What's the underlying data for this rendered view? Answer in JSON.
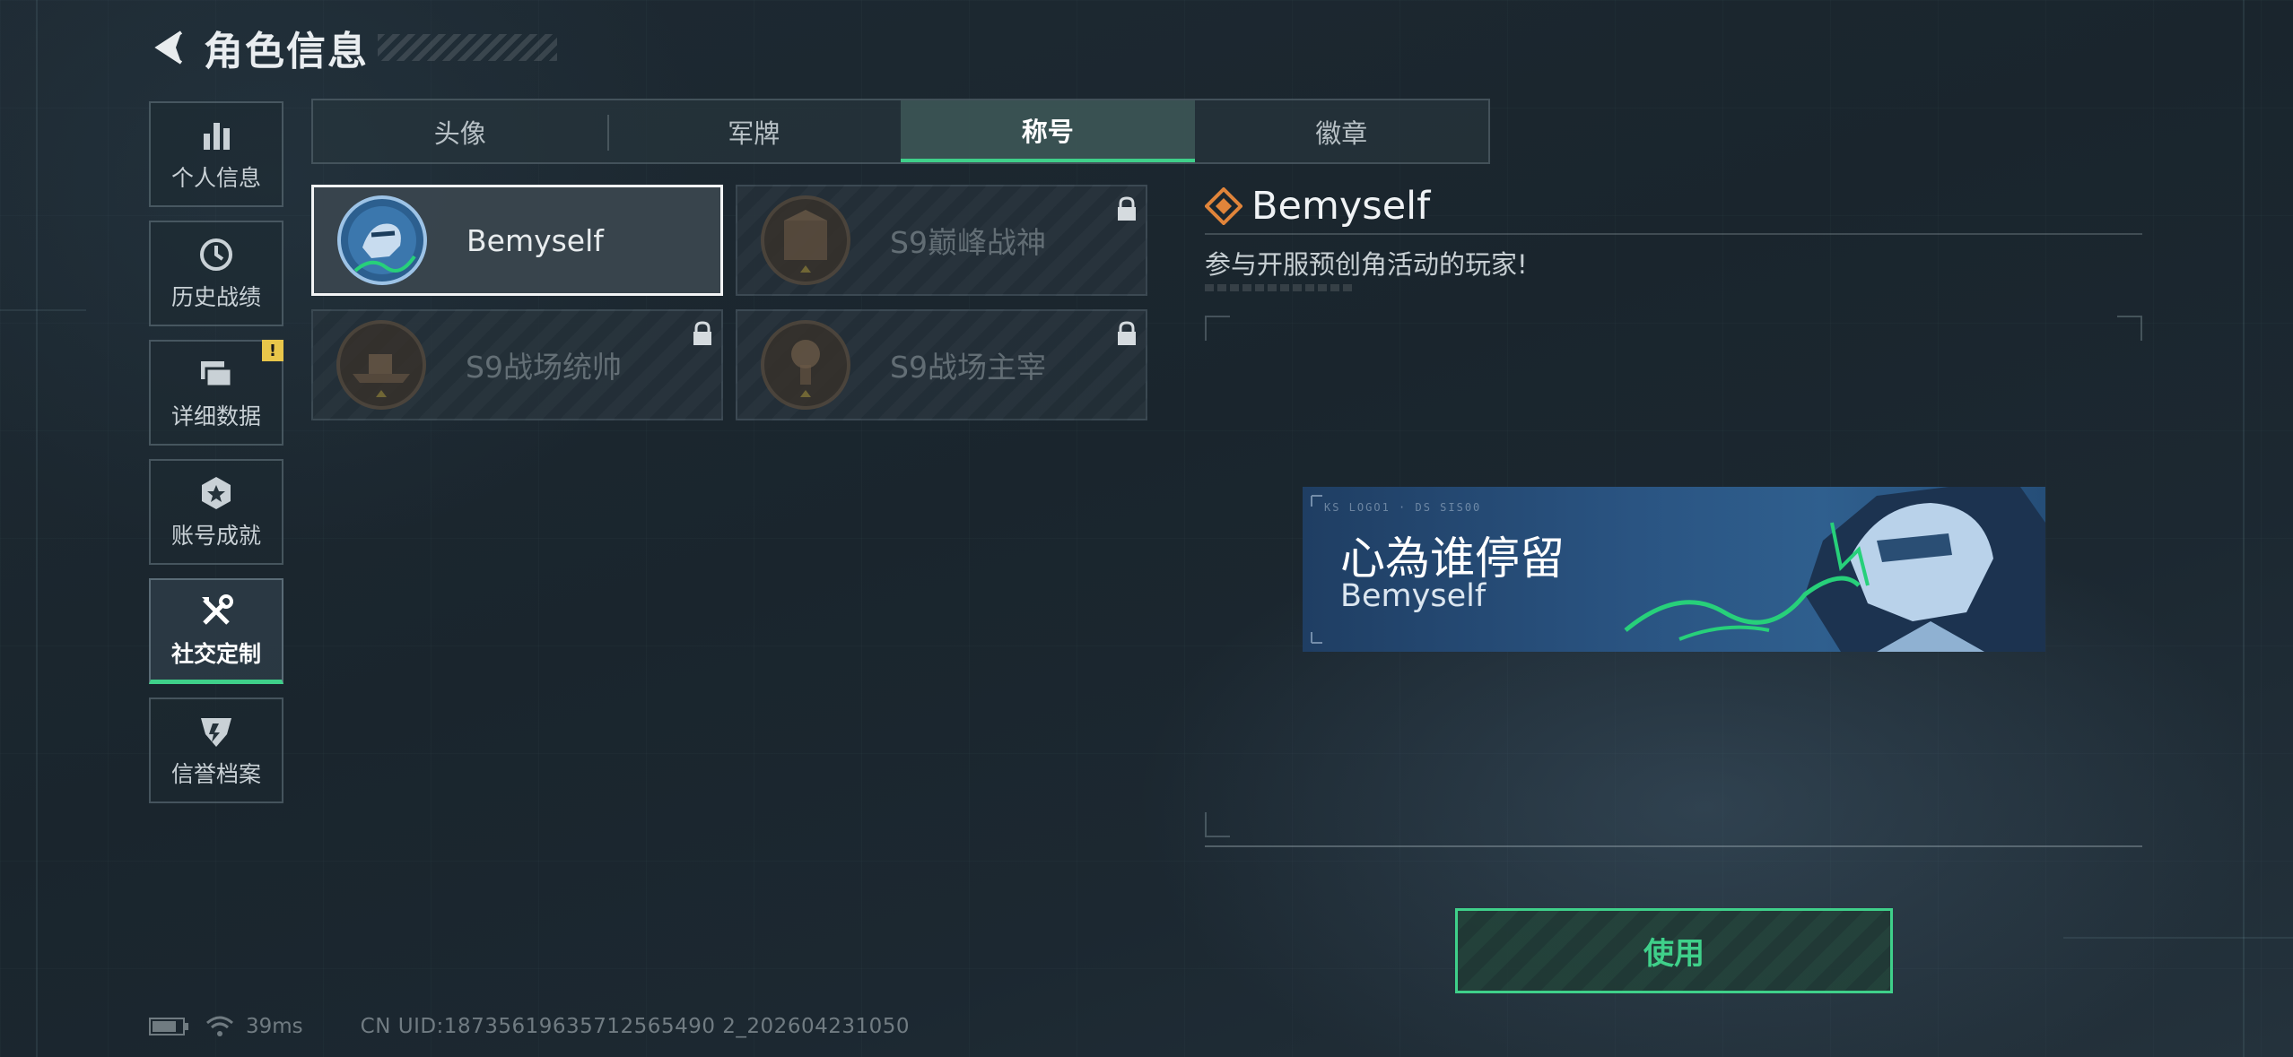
{
  "header": {
    "title": "角色信息"
  },
  "sidebar": {
    "items": [
      {
        "label": "个人信息",
        "icon": "bar-chart-icon"
      },
      {
        "label": "历史战绩",
        "icon": "history-clock-icon"
      },
      {
        "label": "详细数据",
        "icon": "folder-icon",
        "badge": "!"
      },
      {
        "label": "账号成就",
        "icon": "medal-icon"
      },
      {
        "label": "社交定制",
        "icon": "tools-icon",
        "active": true
      },
      {
        "label": "信誉档案",
        "icon": "shield-emblem-icon"
      }
    ]
  },
  "tabs": [
    {
      "label": "头像"
    },
    {
      "label": "军牌"
    },
    {
      "label": "称号",
      "active": true
    },
    {
      "label": "徽章"
    }
  ],
  "titles": [
    {
      "name": "Bemyself",
      "locked": false,
      "selected": true
    },
    {
      "name": "S9巅峰战神",
      "locked": true
    },
    {
      "name": "S9战场统帅",
      "locked": true
    },
    {
      "name": "S9战场主宰",
      "locked": true
    }
  ],
  "detail": {
    "name": "Bemyself",
    "description": "参与开服预创角活动的玩家!",
    "banner": {
      "title": "心為谁停留",
      "subtitle": "Bemyself",
      "tiny_text": "KS LOGO1 · DS SIS00"
    }
  },
  "actions": {
    "use_label": "使用"
  },
  "status": {
    "ping": "39ms",
    "uid": "CN UID:18735619635712565490 2_202604231050"
  },
  "colors": {
    "accent": "#3fd08a",
    "warning": "#e8c64a",
    "banner": "#2a5482"
  }
}
